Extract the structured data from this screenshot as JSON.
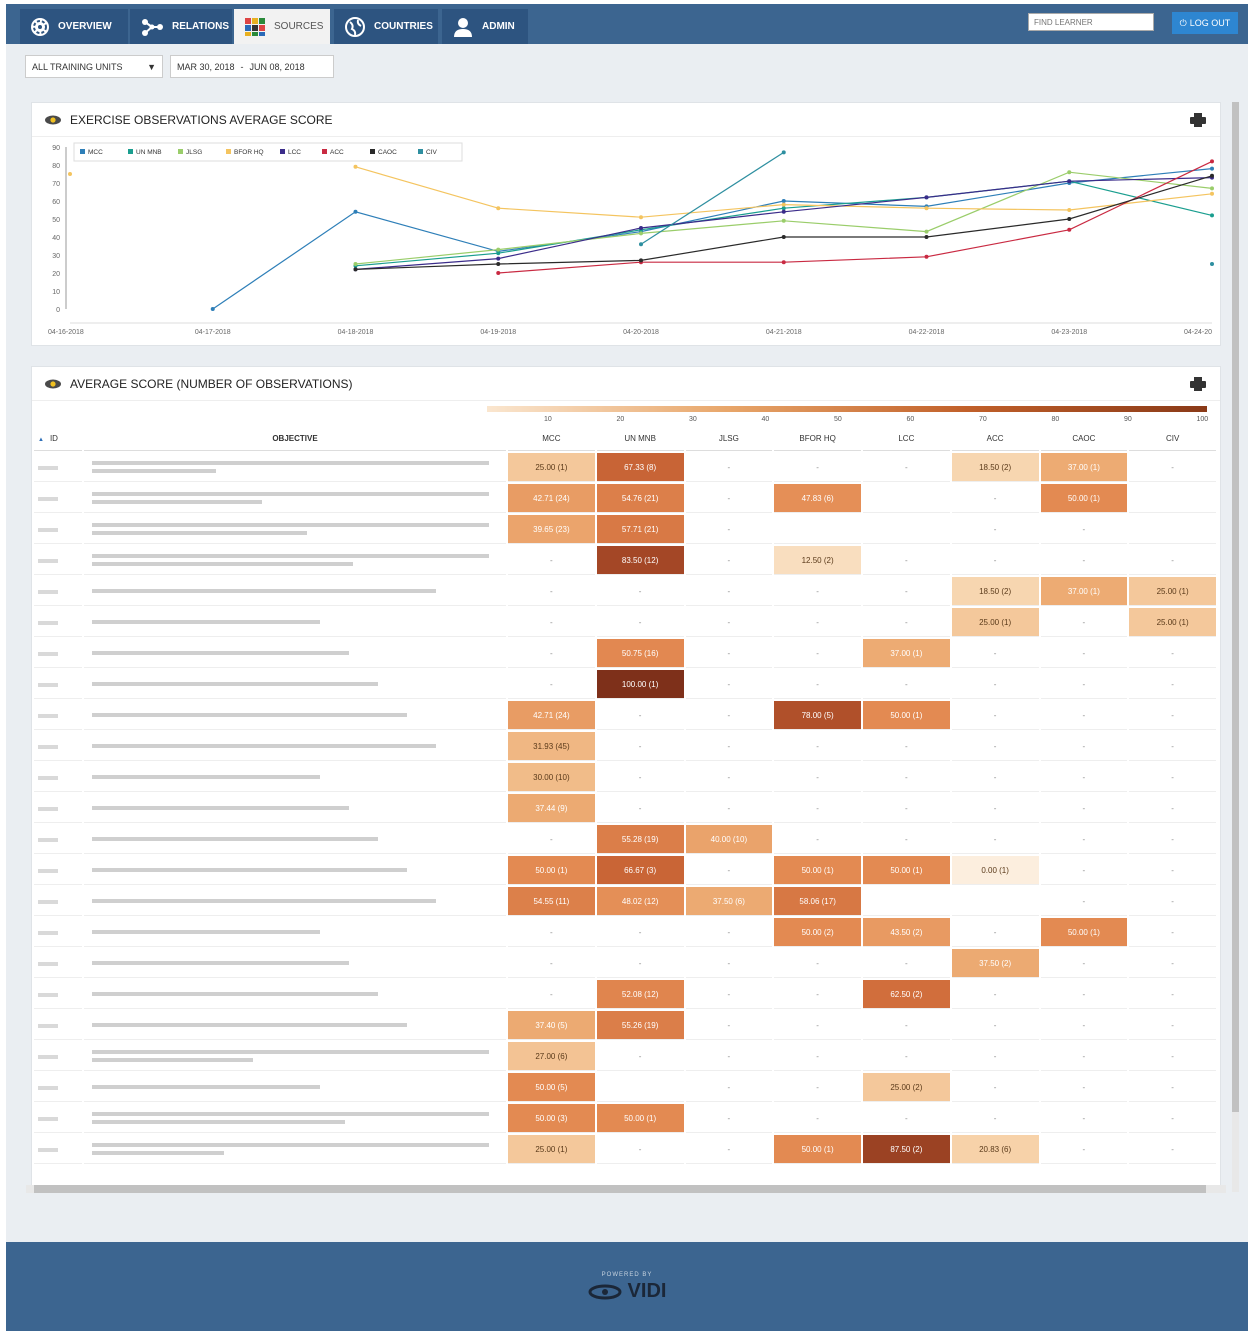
{
  "nav": {
    "tabs": [
      {
        "label": "OVERVIEW",
        "icon": "dashboard-icon"
      },
      {
        "label": "RELATIONS",
        "icon": "network-icon"
      },
      {
        "label": "SOURCES",
        "icon": "grid-icon",
        "active": true
      },
      {
        "label": "COUNTRIES",
        "icon": "globe-icon"
      },
      {
        "label": "ADMIN",
        "icon": "user-icon"
      }
    ],
    "find_placeholder": "FIND LEARNER",
    "logout": "LOG OUT"
  },
  "filters": {
    "unit": "ALL TRAINING UNITS",
    "date_from": "MAR 30, 2018",
    "separator": "-",
    "date_to": "JUN 08, 2018"
  },
  "chart_panel": {
    "title": "EXERCISE OBSERVATIONS AVERAGE SCORE"
  },
  "chart_data": {
    "type": "line",
    "x": [
      "04-16-2018",
      "04-17-2018",
      "04-18-2018",
      "04-19-2018",
      "04-20-2018",
      "04-21-2018",
      "04-22-2018",
      "04-23-2018",
      "04-24-20"
    ],
    "ylim": [
      0,
      90
    ],
    "yticks": [
      0,
      10,
      20,
      30,
      40,
      50,
      60,
      70,
      80,
      90
    ],
    "legend_position": "top-left",
    "series": [
      {
        "name": "MCC",
        "color": "#2e7fb8",
        "values": [
          null,
          0,
          54,
          32,
          43,
          60,
          57,
          70,
          78
        ]
      },
      {
        "name": "UN MNB",
        "color": "#1a9e8f",
        "values": [
          null,
          null,
          24,
          31,
          44,
          56,
          62,
          71,
          52
        ]
      },
      {
        "name": "JLSG",
        "color": "#9acd6a",
        "values": [
          null,
          null,
          25,
          33,
          42,
          49,
          43,
          76,
          67
        ]
      },
      {
        "name": "BFOR HQ",
        "color": "#f4c45f",
        "values": [
          75,
          null,
          79,
          56,
          51,
          58,
          56,
          55,
          64
        ]
      },
      {
        "name": "LCC",
        "color": "#3b2c8a",
        "values": [
          null,
          null,
          22,
          28,
          45,
          54,
          62,
          71,
          73
        ]
      },
      {
        "name": "ACC",
        "color": "#c92a42",
        "values": [
          null,
          null,
          null,
          20,
          26,
          26,
          29,
          44,
          82
        ]
      },
      {
        "name": "CAOC",
        "color": "#2a2a2a",
        "values": [
          null,
          null,
          22,
          25,
          27,
          40,
          40,
          50,
          74
        ]
      },
      {
        "name": "CIV",
        "color": "#2e8fa0",
        "values": [
          null,
          null,
          null,
          null,
          36,
          87,
          null,
          null,
          25
        ]
      }
    ]
  },
  "table_panel": {
    "title": "AVERAGE SCORE (NUMBER OF OBSERVATIONS)",
    "scale_ticks": [
      "10",
      "20",
      "30",
      "40",
      "50",
      "60",
      "70",
      "80",
      "90",
      "100"
    ],
    "columns": [
      "ID",
      "OBJECTIVE",
      "MCC",
      "UN MNB",
      "JLSG",
      "BFOR HQ",
      "LCC",
      "ACC",
      "CAOC",
      "CIV"
    ],
    "sort_icon": "▲",
    "rows": [
      {
        "lines": 2,
        "cells": [
          "25.00 (1)",
          "67.33 (8)",
          "-",
          "-",
          "-",
          "18.50 (2)",
          "37.00 (1)",
          "-"
        ]
      },
      {
        "lines": 2,
        "cells": [
          "42.71 (24)",
          "54.76 (21)",
          "-",
          "47.83 (6)",
          "",
          "-",
          "50.00 (1)",
          ""
        ]
      },
      {
        "lines": 2,
        "cells": [
          "39.65 (23)",
          "57.71 (21)",
          "-",
          "",
          "",
          "-",
          "-",
          ""
        ]
      },
      {
        "lines": 2,
        "cells": [
          "-",
          "83.50 (12)",
          "-",
          "12.50 (2)",
          "-",
          "-",
          "-",
          "-"
        ]
      },
      {
        "lines": 1,
        "cells": [
          "-",
          "-",
          "-",
          "-",
          "-",
          "18.50 (2)",
          "37.00 (1)",
          "25.00 (1)"
        ]
      },
      {
        "lines": 1,
        "cells": [
          "-",
          "-",
          "-",
          "-",
          "-",
          "25.00 (1)",
          "-",
          "25.00 (1)"
        ]
      },
      {
        "lines": 1,
        "cells": [
          "-",
          "50.75 (16)",
          "-",
          "-",
          "37.00 (1)",
          "-",
          "-",
          "-"
        ]
      },
      {
        "lines": 1,
        "cells": [
          "-",
          "100.00 (1)",
          "-",
          "-",
          "-",
          "-",
          "-",
          "-"
        ]
      },
      {
        "lines": 1,
        "cells": [
          "42.71 (24)",
          "-",
          "-",
          "78.00 (5)",
          "50.00 (1)",
          "-",
          "-",
          "-"
        ]
      },
      {
        "lines": 1,
        "cells": [
          "31.93 (45)",
          "-",
          "-",
          "-",
          "-",
          "-",
          "-",
          "-"
        ]
      },
      {
        "lines": 1,
        "cells": [
          "30.00 (10)",
          "-",
          "-",
          "-",
          "-",
          "-",
          "-",
          "-"
        ]
      },
      {
        "lines": 1,
        "cells": [
          "37.44 (9)",
          "-",
          "-",
          "-",
          "-",
          "-",
          "-",
          "-"
        ]
      },
      {
        "lines": 1,
        "cells": [
          "-",
          "55.28 (19)",
          "40.00 (10)",
          "-",
          "-",
          "-",
          "-",
          "-"
        ]
      },
      {
        "lines": 1,
        "cells": [
          "50.00 (1)",
          "66.67 (3)",
          "-",
          "50.00 (1)",
          "50.00 (1)",
          "0.00 (1)",
          "-",
          "-"
        ]
      },
      {
        "lines": 1,
        "cells": [
          "54.55 (11)",
          "48.02 (12)",
          "37.50 (6)",
          "58.06 (17)",
          "",
          "",
          "-",
          "-"
        ]
      },
      {
        "lines": 1,
        "cells": [
          "-",
          "-",
          "-",
          "50.00 (2)",
          "43.50 (2)",
          "-",
          "50.00 (1)",
          "-"
        ]
      },
      {
        "lines": 1,
        "cells": [
          "-",
          "-",
          "-",
          "-",
          "-",
          "37.50 (2)",
          "-",
          "-"
        ]
      },
      {
        "lines": 1,
        "cells": [
          "-",
          "52.08 (12)",
          "-",
          "-",
          "62.50 (2)",
          "-",
          "-",
          "-"
        ]
      },
      {
        "lines": 1,
        "cells": [
          "37.40 (5)",
          "55.26 (19)",
          "-",
          "-",
          "-",
          "-",
          "-",
          "-"
        ]
      },
      {
        "lines": 2,
        "cells": [
          "27.00 (6)",
          "-",
          "-",
          "-",
          "-",
          "-",
          "-",
          "-"
        ]
      },
      {
        "lines": 1,
        "cells": [
          "50.00 (5)",
          "",
          "-",
          "-",
          "25.00 (2)",
          "-",
          "-",
          "-"
        ]
      },
      {
        "lines": 2,
        "cells": [
          "50.00 (3)",
          "50.00 (1)",
          "-",
          "-",
          "-",
          "-",
          "-",
          "-"
        ]
      },
      {
        "lines": 2,
        "cells": [
          "25.00 (1)",
          "-",
          "-",
          "50.00 (1)",
          "87.50 (2)",
          "20.83 (6)",
          "-",
          "-"
        ]
      }
    ]
  },
  "footer": {
    "powered": "POWERED BY",
    "brand": "VIDI"
  }
}
